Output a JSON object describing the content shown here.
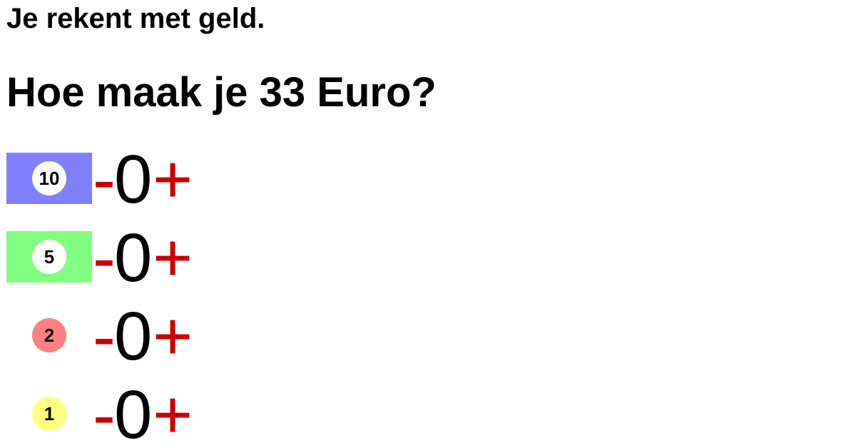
{
  "exercise": {
    "subtitle": "Je rekent met geld.",
    "question": "Hoe maak je 33 Euro?"
  },
  "controls": {
    "decrement_label": "-",
    "increment_label": "+",
    "control_color": "#cc0000"
  },
  "denominations": [
    {
      "value": "10",
      "count": "0",
      "kind": "bill",
      "bill_color": "#8080ff",
      "coin_color": "#ffffff"
    },
    {
      "value": "5",
      "count": "0",
      "kind": "bill",
      "bill_color": "#80ff80",
      "coin_color": "#ffffff"
    },
    {
      "value": "2",
      "count": "0",
      "kind": "coin",
      "bill_color": "#ffffff",
      "coin_color": "#ff8080"
    },
    {
      "value": "1",
      "count": "0",
      "kind": "coin",
      "bill_color": "#ffffff",
      "coin_color": "#ffff80"
    }
  ]
}
